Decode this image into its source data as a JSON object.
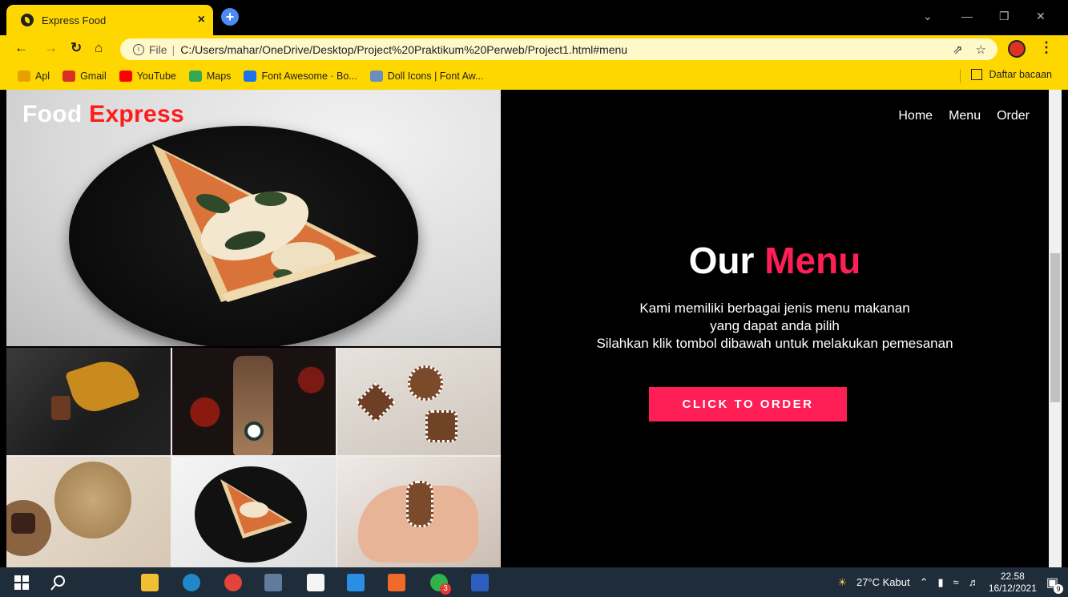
{
  "browser": {
    "tab_title": "Express Food",
    "tab_close": "×",
    "new_tab": "+",
    "url_scheme": "File",
    "url_path": "C:/Users/mahar/OneDrive/Desktop/Project%20Praktikum%20Perweb/Project1.html#menu",
    "bookmarks": [
      {
        "label": "Apl",
        "color": "#e8a000"
      },
      {
        "label": "Gmail",
        "color": "#d93025"
      },
      {
        "label": "YouTube",
        "color": "#ff0000"
      },
      {
        "label": "Maps",
        "color": "#34a853"
      },
      {
        "label": "Font Awesome · Bo...",
        "color": "#1a73e8"
      },
      {
        "label": "Doll Icons | Font Aw...",
        "color": "#6c8ebf"
      }
    ],
    "reading_list": "Daftar bacaan"
  },
  "page": {
    "logo_main": "Food ",
    "logo_accent": "Express",
    "nav": [
      "Home",
      "Menu",
      "Order"
    ],
    "title_main": "Our ",
    "title_accent": "Menu",
    "desc_lines": [
      "Kami memiliki berbagai jenis menu makanan",
      "yang dapat anda pilih",
      "Silahkan klik tombol dibawah untuk melakukan pemesanan"
    ],
    "order_button": "CLICK TO ORDER",
    "accent_color": "#ff1e56",
    "logo_accent_color": "#ff1a1a"
  },
  "taskbar": {
    "weather": "27°C  Kabut",
    "time": "22.58",
    "date": "16/12/2021",
    "notification_count": "9",
    "chrome_badge": "3"
  }
}
